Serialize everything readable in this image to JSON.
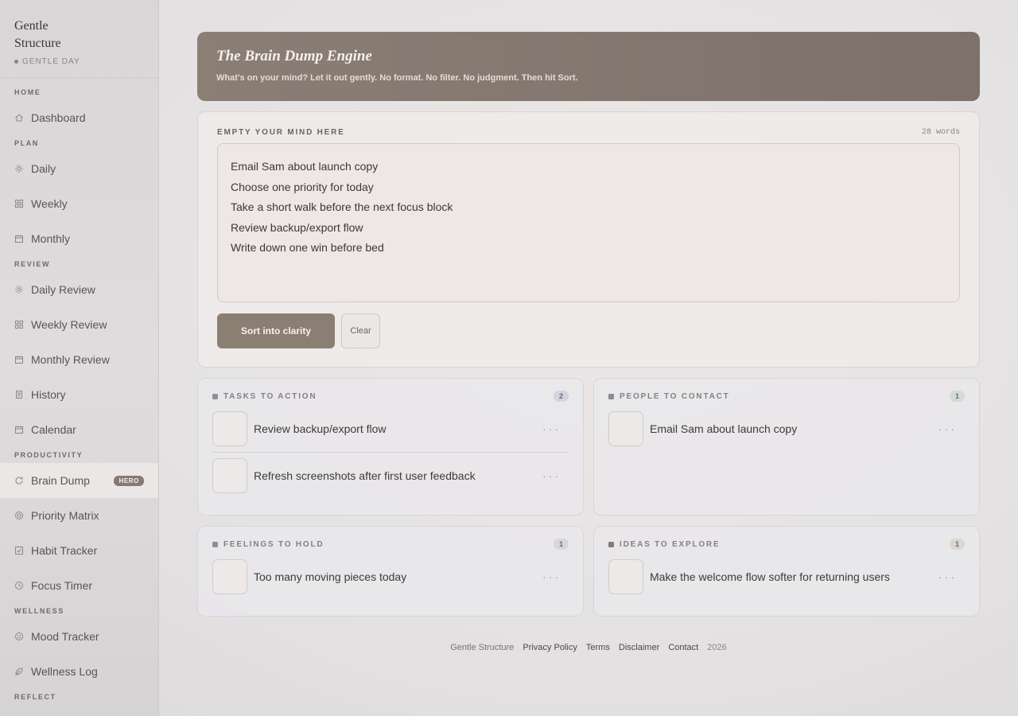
{
  "brand": {
    "name": "Gentle Structure",
    "sub": "GENTLE DAY"
  },
  "sidebar": {
    "sections": [
      {
        "label": "HOME",
        "items": [
          {
            "label": "Dashboard",
            "icon": "home-icon"
          }
        ]
      },
      {
        "label": "PLAN",
        "items": [
          {
            "label": "Daily",
            "icon": "sun-icon"
          },
          {
            "label": "Weekly",
            "icon": "grid-icon"
          },
          {
            "label": "Monthly",
            "icon": "calendar-icon"
          }
        ]
      },
      {
        "label": "REVIEW",
        "items": [
          {
            "label": "Daily Review",
            "icon": "sun-icon"
          },
          {
            "label": "Weekly Review",
            "icon": "grid-icon"
          },
          {
            "label": "Monthly Review",
            "icon": "calendar-icon"
          },
          {
            "label": "History",
            "icon": "document-icon"
          },
          {
            "label": "Calendar",
            "icon": "calendar-icon"
          }
        ]
      },
      {
        "label": "PRODUCTIVITY",
        "items": [
          {
            "label": "Brain Dump",
            "icon": "refresh-icon",
            "badge": "HERO",
            "active": true
          },
          {
            "label": "Priority Matrix",
            "icon": "target-icon"
          },
          {
            "label": "Habit Tracker",
            "icon": "checkbox-icon"
          },
          {
            "label": "Focus Timer",
            "icon": "clock-icon"
          }
        ]
      },
      {
        "label": "WELLNESS",
        "items": [
          {
            "label": "Mood Tracker",
            "icon": "smile-icon"
          },
          {
            "label": "Wellness Log",
            "icon": "leaf-icon"
          }
        ]
      },
      {
        "label": "REFLECT",
        "items": []
      }
    ]
  },
  "banner": {
    "title": "The Brain Dump Engine",
    "subtitle": "What's on your mind? Let it out gently. No format. No filter. No judgment. Then hit Sort."
  },
  "dump": {
    "label": "EMPTY YOUR MIND HERE",
    "word_count": "28 words",
    "lines": [
      "Email Sam about launch copy",
      "Choose one priority for today",
      "Take a short walk before the next focus block",
      "Review backup/export flow",
      "Write down one win before bed"
    ],
    "sort_label": "Sort into clarity",
    "clear_label": "Clear"
  },
  "buckets": {
    "tasks": {
      "title": "TASKS TO ACTION",
      "count": "2",
      "color": "#8d8f9c",
      "badge_bg": "#d3d4df",
      "items": [
        "Review backup/export flow",
        "Refresh screenshots after first user feedback"
      ]
    },
    "people": {
      "title": "PEOPLE TO CONTACT",
      "count": "1",
      "color": "#8f8a8d",
      "badge_bg": "#d2dbd4",
      "items": [
        "Email Sam about launch copy"
      ]
    },
    "feelings": {
      "title": "FEELINGS TO HOLD",
      "count": "1",
      "color": "#8d8f9c",
      "badge_bg": "#d7d6e0",
      "items": [
        "Too many moving pieces today"
      ]
    },
    "ideas": {
      "title": "IDEAS TO EXPLORE",
      "count": "1",
      "color": "#857a72",
      "badge_bg": "#dcd5d1",
      "items": [
        "Make the welcome flow softer for returning users"
      ]
    }
  },
  "more_label": "···",
  "footer": {
    "brand": "Gentle Structure",
    "links": [
      "Privacy Policy",
      "Terms",
      "Disclaimer",
      "Contact"
    ],
    "year": "2026"
  }
}
